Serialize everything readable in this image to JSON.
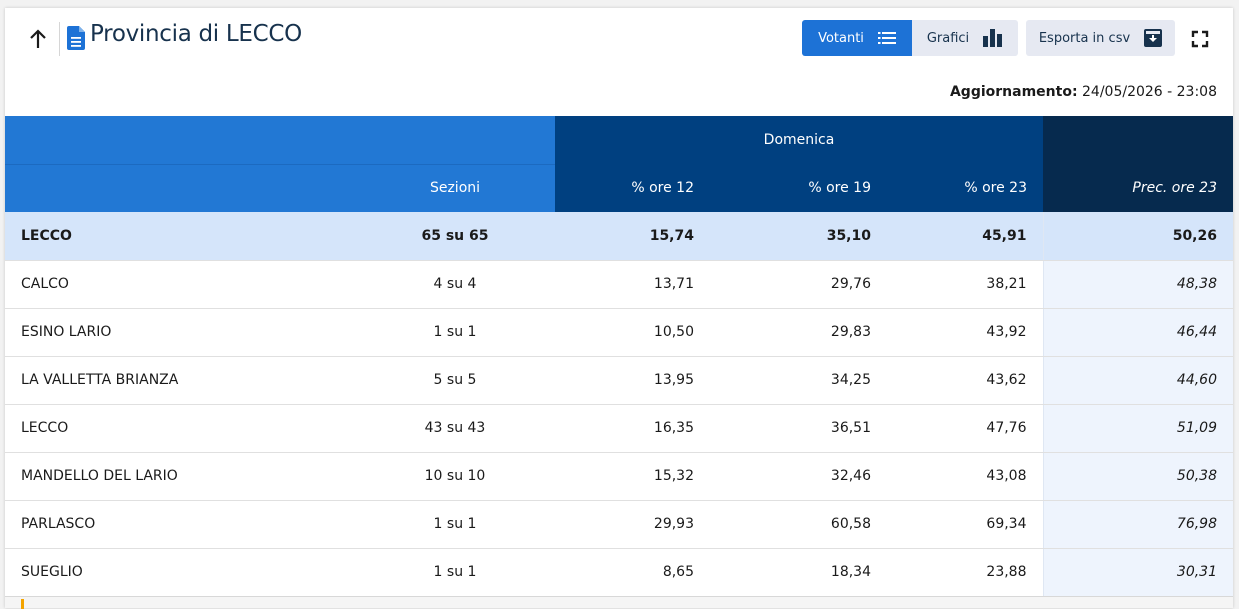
{
  "header": {
    "title": "Provincia di LECCO",
    "buttons": {
      "votanti": "Votanti",
      "grafici": "Grafici",
      "esporta": "Esporta in csv"
    },
    "update_label": "Aggiornamento:",
    "update_value": "24/05/2026 - 23:08"
  },
  "icons": [
    "arrow-up-icon",
    "document-icon",
    "list-icon",
    "bar-chart-icon",
    "download-icon",
    "fullscreen-icon"
  ],
  "colors": {
    "primary": "#1d72d6",
    "header_dark": "#004080",
    "header_darker": "#062a4e",
    "total_row": "#d5e5fa",
    "prev_col": "#eef4fd",
    "footer_accent": "#f4a400"
  },
  "table": {
    "group_header": "Domenica",
    "columns": {
      "sezioni": "Sezioni",
      "ore12": "% ore 12",
      "ore19": "% ore 19",
      "ore23": "% ore 23",
      "prec": "Prec. ore 23"
    },
    "total": {
      "name": "LECCO",
      "sezioni": "65 su 65",
      "ore12": "15,74",
      "ore19": "35,10",
      "ore23": "45,91",
      "prec": "50,26"
    },
    "rows": [
      {
        "name": "CALCO",
        "sezioni": "4 su 4",
        "ore12": "13,71",
        "ore19": "29,76",
        "ore23": "38,21",
        "prec": "48,38"
      },
      {
        "name": "ESINO LARIO",
        "sezioni": "1 su 1",
        "ore12": "10,50",
        "ore19": "29,83",
        "ore23": "43,92",
        "prec": "46,44"
      },
      {
        "name": "LA VALLETTA BRIANZA",
        "sezioni": "5 su 5",
        "ore12": "13,95",
        "ore19": "34,25",
        "ore23": "43,62",
        "prec": "44,60"
      },
      {
        "name": "LECCO",
        "sezioni": "43 su 43",
        "ore12": "16,35",
        "ore19": "36,51",
        "ore23": "47,76",
        "prec": "51,09"
      },
      {
        "name": "MANDELLO DEL LARIO",
        "sezioni": "10 su 10",
        "ore12": "15,32",
        "ore19": "32,46",
        "ore23": "43,08",
        "prec": "50,38"
      },
      {
        "name": "PARLASCO",
        "sezioni": "1 su 1",
        "ore12": "29,93",
        "ore19": "60,58",
        "ore23": "69,34",
        "prec": "76,98"
      },
      {
        "name": "SUEGLIO",
        "sezioni": "1 su 1",
        "ore12": "8,65",
        "ore19": "18,34",
        "ore23": "23,88",
        "prec": "30,31"
      }
    ]
  }
}
